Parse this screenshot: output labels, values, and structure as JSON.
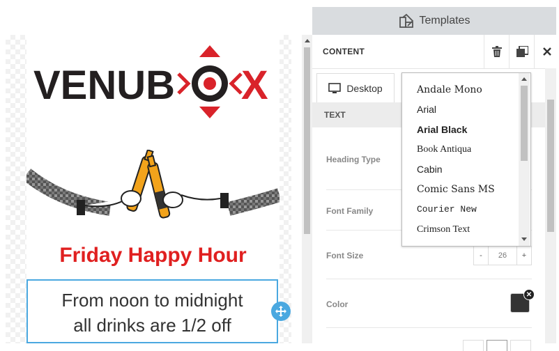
{
  "canvas": {
    "logo_text_left": "VENUB",
    "logo_text_right": "X",
    "heading": "Friday Happy Hour",
    "body_line1": "From noon to midnight",
    "body_line2": "all drinks are 1/2 off",
    "brand_red": "#d9232a",
    "brand_dark": "#231f20",
    "selection_color": "#4aa8e0"
  },
  "panel": {
    "templates_label": "Templates",
    "content_title": "CONTENT",
    "delete_icon": "trash-icon",
    "duplicate_icon": "copy-icon",
    "close_icon": "close-icon",
    "tab_desktop_label": "Desktop",
    "section_text_label": "TEXT",
    "heading_type_label": "Heading Type",
    "font_family_label": "Font Family",
    "font_size_label": "Font Size",
    "font_size_value": "26",
    "font_size_minus": "-",
    "font_size_plus": "+",
    "color_label": "Color",
    "color_value": "#333333"
  },
  "font_dropdown": {
    "options": [
      "Andale Mono",
      "Arial",
      "Arial Black",
      "Book Antiqua",
      "Cabin",
      "Comic Sans MS",
      "Courier New",
      "Crimson Text"
    ]
  }
}
